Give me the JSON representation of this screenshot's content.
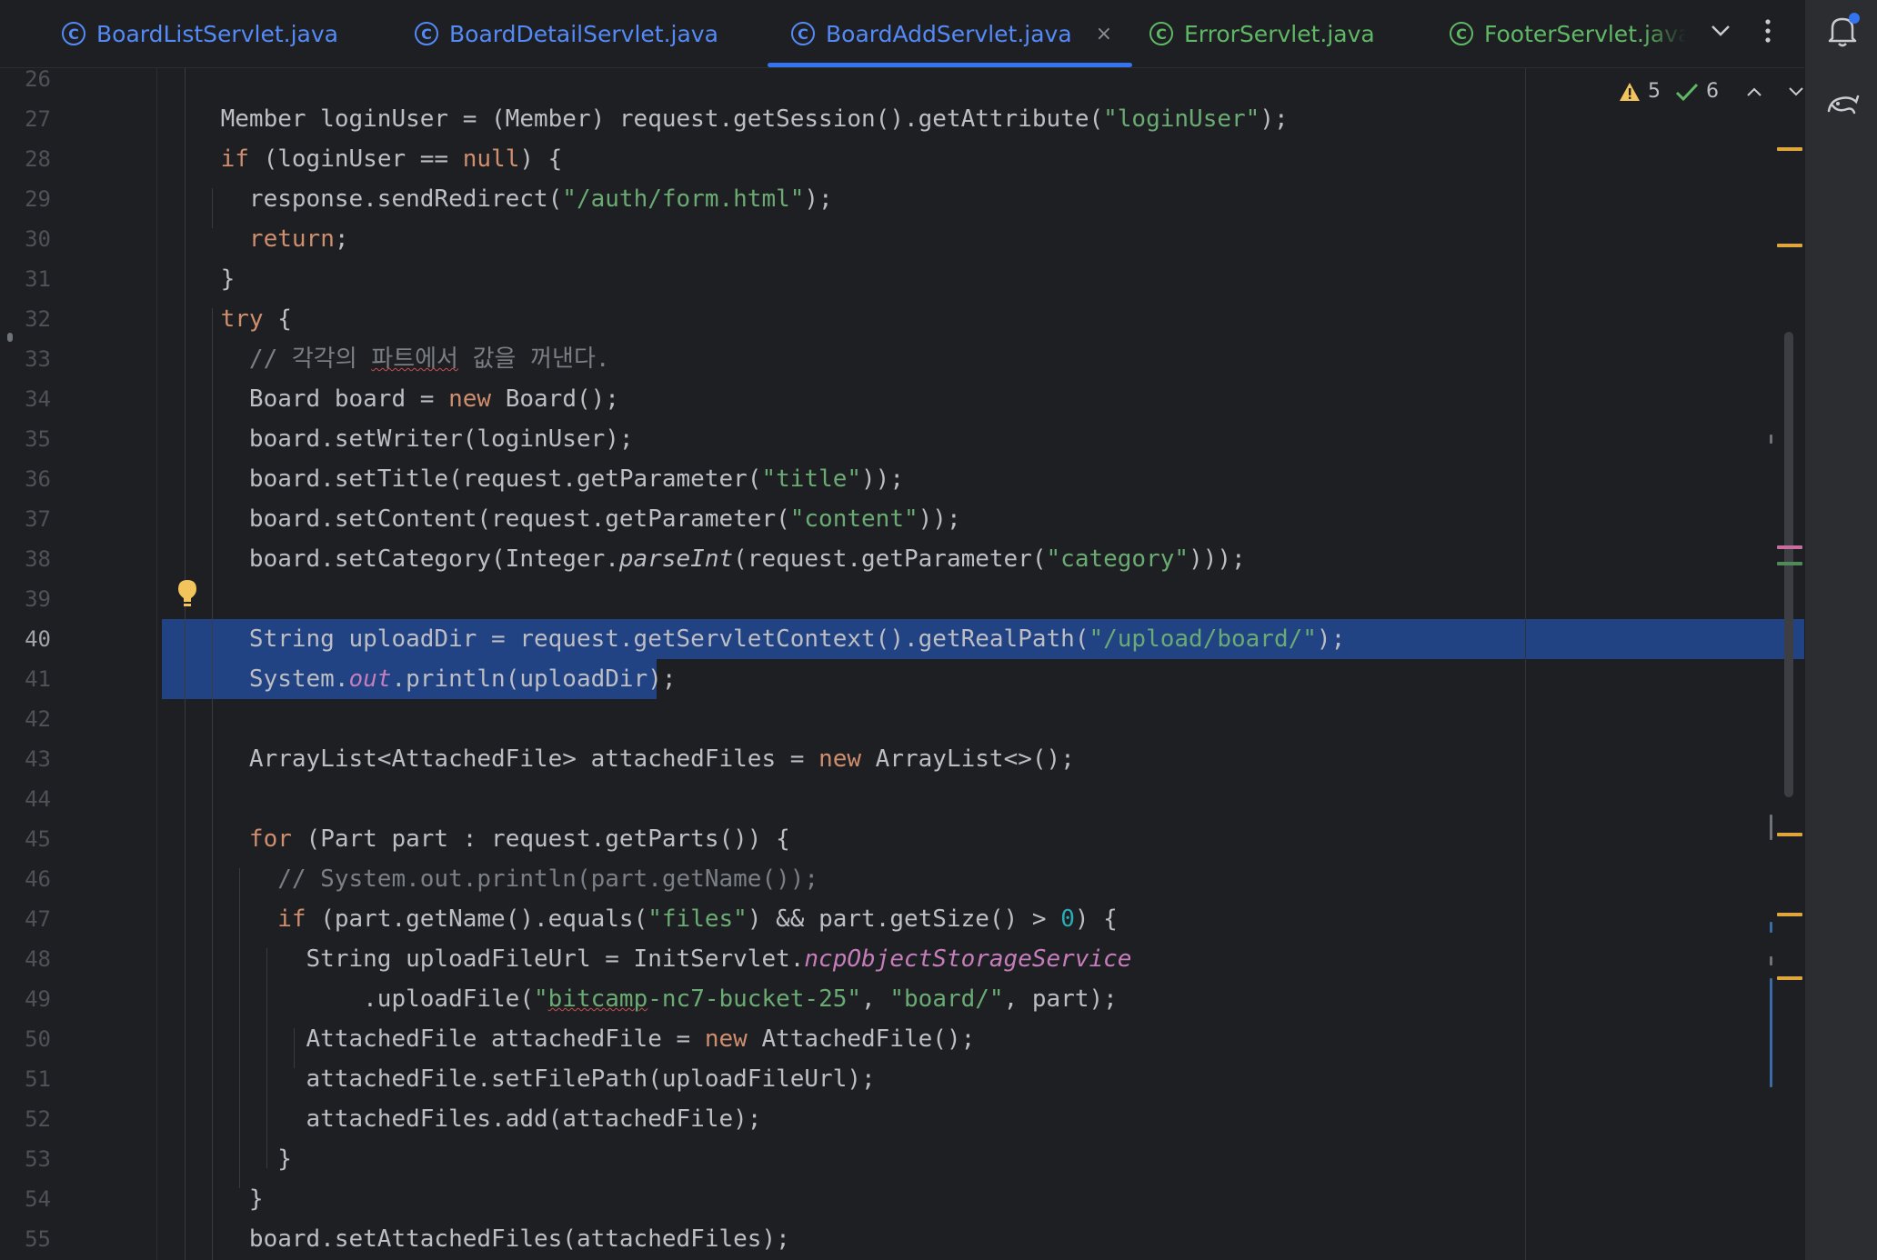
{
  "tabs": [
    {
      "label": "BoardListServlet.java",
      "active": false
    },
    {
      "label": "BoardDetailServlet.java",
      "active": false
    },
    {
      "label": "BoardAddServlet.java",
      "active": true
    },
    {
      "label": "ErrorServlet.java",
      "active": false
    },
    {
      "label": "FooterServlet.java",
      "active": false
    }
  ],
  "tab_close_glyph": "×",
  "inspections": {
    "warnings": "5",
    "ok": "6"
  },
  "line_numbers": [
    "26",
    "27",
    "28",
    "29",
    "30",
    "31",
    "32",
    "33",
    "34",
    "35",
    "36",
    "37",
    "38",
    "39",
    "40",
    "41",
    "42",
    "43",
    "44",
    "45",
    "46",
    "47",
    "48",
    "49",
    "50",
    "51",
    "52",
    "53",
    "54",
    "55"
  ],
  "current_line": "40",
  "code": [
    [],
    [
      {
        "t": "    Member loginUser = (Member) request.getSession().getAttribute("
      },
      {
        "t": "\"loginUser\"",
        "c": "str"
      },
      {
        "t": ");"
      }
    ],
    [
      {
        "t": "    "
      },
      {
        "t": "if",
        "c": "kw"
      },
      {
        "t": " (loginUser == "
      },
      {
        "t": "null",
        "c": "kw"
      },
      {
        "t": ") {"
      }
    ],
    [
      {
        "t": "      response.sendRedirect("
      },
      {
        "t": "\"/auth/form.html\"",
        "c": "str"
      },
      {
        "t": ");"
      }
    ],
    [
      {
        "t": "      "
      },
      {
        "t": "return",
        "c": "kw"
      },
      {
        "t": ";"
      }
    ],
    [
      {
        "t": "    }"
      }
    ],
    [
      {
        "t": "    "
      },
      {
        "t": "try",
        "c": "kw"
      },
      {
        "t": " {"
      }
    ],
    [
      {
        "t": "      // 각각의 ",
        "c": "cm"
      },
      {
        "t": "파트에서",
        "c": "cm squig"
      },
      {
        "t": " 값을 꺼낸다.",
        "c": "cm"
      }
    ],
    [
      {
        "t": "      Board board = "
      },
      {
        "t": "new",
        "c": "kw"
      },
      {
        "t": " Board();"
      }
    ],
    [
      {
        "t": "      board.setWriter(loginUser);"
      }
    ],
    [
      {
        "t": "      board.setTitle(request.getParameter("
      },
      {
        "t": "\"title\"",
        "c": "str"
      },
      {
        "t": "));"
      }
    ],
    [
      {
        "t": "      board.setContent(request.getParameter("
      },
      {
        "t": "\"content\"",
        "c": "str"
      },
      {
        "t": "));"
      }
    ],
    [
      {
        "t": "      board.setCategory(Integer."
      },
      {
        "t": "parseInt",
        "c": "it"
      },
      {
        "t": "(request.getParameter("
      },
      {
        "t": "\"category\"",
        "c": "str"
      },
      {
        "t": ")));"
      }
    ],
    [],
    [
      {
        "t": "      String uploadDir = request.getServletContext().getRealPath("
      },
      {
        "t": "\"/upload/board/\"",
        "c": "str"
      },
      {
        "t": ");"
      }
    ],
    [
      {
        "t": "      System."
      },
      {
        "t": "out",
        "c": "stat"
      },
      {
        "t": ".println(uploadDir);"
      }
    ],
    [],
    [
      {
        "t": "      ArrayList<AttachedFile> attachedFiles = "
      },
      {
        "t": "new",
        "c": "kw"
      },
      {
        "t": " ArrayList<>();"
      }
    ],
    [],
    [
      {
        "t": "      "
      },
      {
        "t": "for",
        "c": "kw"
      },
      {
        "t": " (Part part : request.getParts()) {"
      }
    ],
    [
      {
        "t": "        // System.out.println(part.getName());",
        "c": "cm"
      }
    ],
    [
      {
        "t": "        "
      },
      {
        "t": "if",
        "c": "kw"
      },
      {
        "t": " (part.getName().equals("
      },
      {
        "t": "\"files\"",
        "c": "str"
      },
      {
        "t": ") && part.getSize() > "
      },
      {
        "t": "0",
        "c": "num"
      },
      {
        "t": ") {"
      }
    ],
    [
      {
        "t": "          String uploadFileUrl = InitServlet."
      },
      {
        "t": "ncpObjectStorageService",
        "c": "stat"
      }
    ],
    [
      {
        "t": "              .uploadFile("
      },
      {
        "t": "\"",
        "c": "str"
      },
      {
        "t": "bitcamp",
        "c": "str squig"
      },
      {
        "t": "-nc7-bucket-25\"",
        "c": "str"
      },
      {
        "t": ", "
      },
      {
        "t": "\"board/\"",
        "c": "str"
      },
      {
        "t": ", part);"
      }
    ],
    [
      {
        "t": "          AttachedFile attachedFile = "
      },
      {
        "t": "new",
        "c": "kw"
      },
      {
        "t": " AttachedFile();"
      }
    ],
    [
      {
        "t": "          attachedFile.setFilePath(uploadFileUrl);"
      }
    ],
    [
      {
        "t": "          attachedFiles.add(attachedFile);"
      }
    ],
    [
      {
        "t": "        }"
      }
    ],
    [
      {
        "t": "      }"
      }
    ],
    [
      {
        "t": "      board.setAttachedFiles(attachedFiles);"
      }
    ]
  ],
  "colors": {
    "background": "#1e1f22",
    "selection": "#214283",
    "keyword": "#cf8e6d",
    "string": "#6aab73",
    "comment": "#7a7e85",
    "static_field": "#c77dbb",
    "accent": "#548af7",
    "warning": "#f2c55c",
    "ok": "#5fb865"
  }
}
